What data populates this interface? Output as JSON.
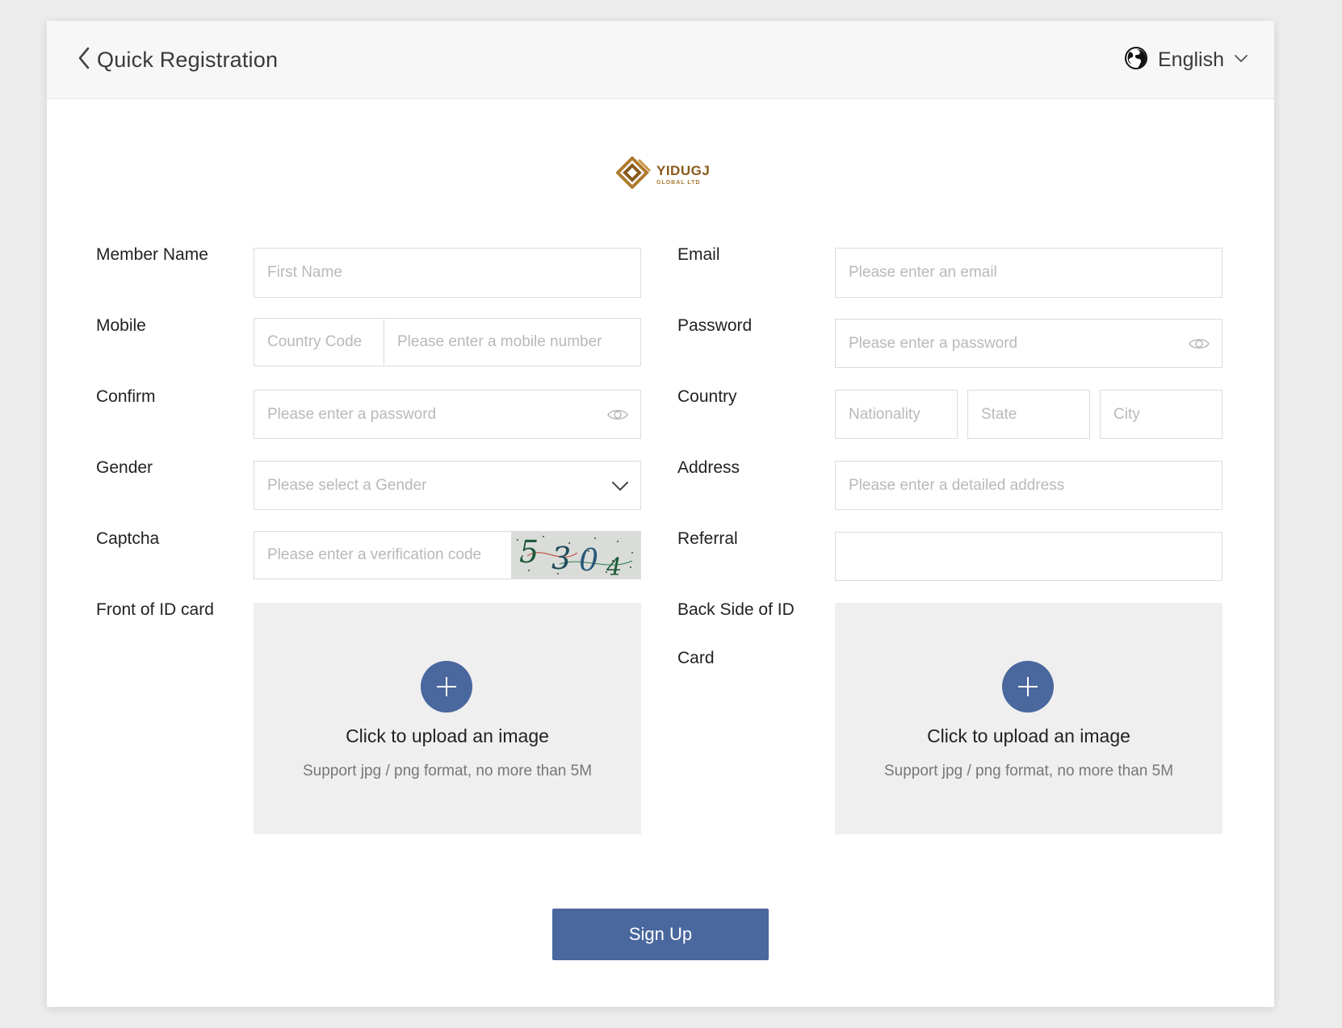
{
  "header": {
    "title": "Quick Registration",
    "language": "English"
  },
  "logo": {
    "name": "YIDUGJ",
    "subtitle": "GLOBAL LTD"
  },
  "form": {
    "member_name": {
      "label": "Member Name",
      "placeholder": "First Name"
    },
    "email": {
      "label": "Email",
      "placeholder": "Please enter an email"
    },
    "mobile": {
      "label": "Mobile",
      "code_placeholder": "Country Code",
      "placeholder": "Please enter a mobile number"
    },
    "password": {
      "label": "Password",
      "placeholder": "Please enter a password"
    },
    "confirm": {
      "label": "Confirm",
      "placeholder": "Please enter a password"
    },
    "country": {
      "label": "Country",
      "nationality_placeholder": "Nationality",
      "state_placeholder": "State",
      "city_placeholder": "City"
    },
    "gender": {
      "label": "Gender",
      "placeholder": "Please select a Gender"
    },
    "address": {
      "label": "Address",
      "placeholder": "Please enter a detailed address"
    },
    "captcha": {
      "label": "Captcha",
      "placeholder": "Please enter a verification code",
      "code": "5304"
    },
    "referral": {
      "label": "Referral",
      "value": ""
    },
    "id_front": {
      "label": "Front of ID card",
      "title": "Click to upload an image",
      "hint": "Support jpg / png format, no more than 5M"
    },
    "id_back": {
      "label_line1": "Back Side of ID",
      "label_line2": "Card",
      "title": "Click to upload an image",
      "hint": "Support jpg / png format, no more than 5M"
    }
  },
  "actions": {
    "submit_label": "Sign Up"
  },
  "colors": {
    "primary": "#4a679e",
    "logo_gold": "#8a5a1c",
    "header_bg": "#f7f7f7",
    "upload_bg": "#efefef"
  },
  "icons": {
    "back": "chevron-left-icon",
    "language": "globe-icon",
    "dropdown": "chevron-down-icon",
    "eye": "eye-icon",
    "plus": "plus-icon"
  }
}
